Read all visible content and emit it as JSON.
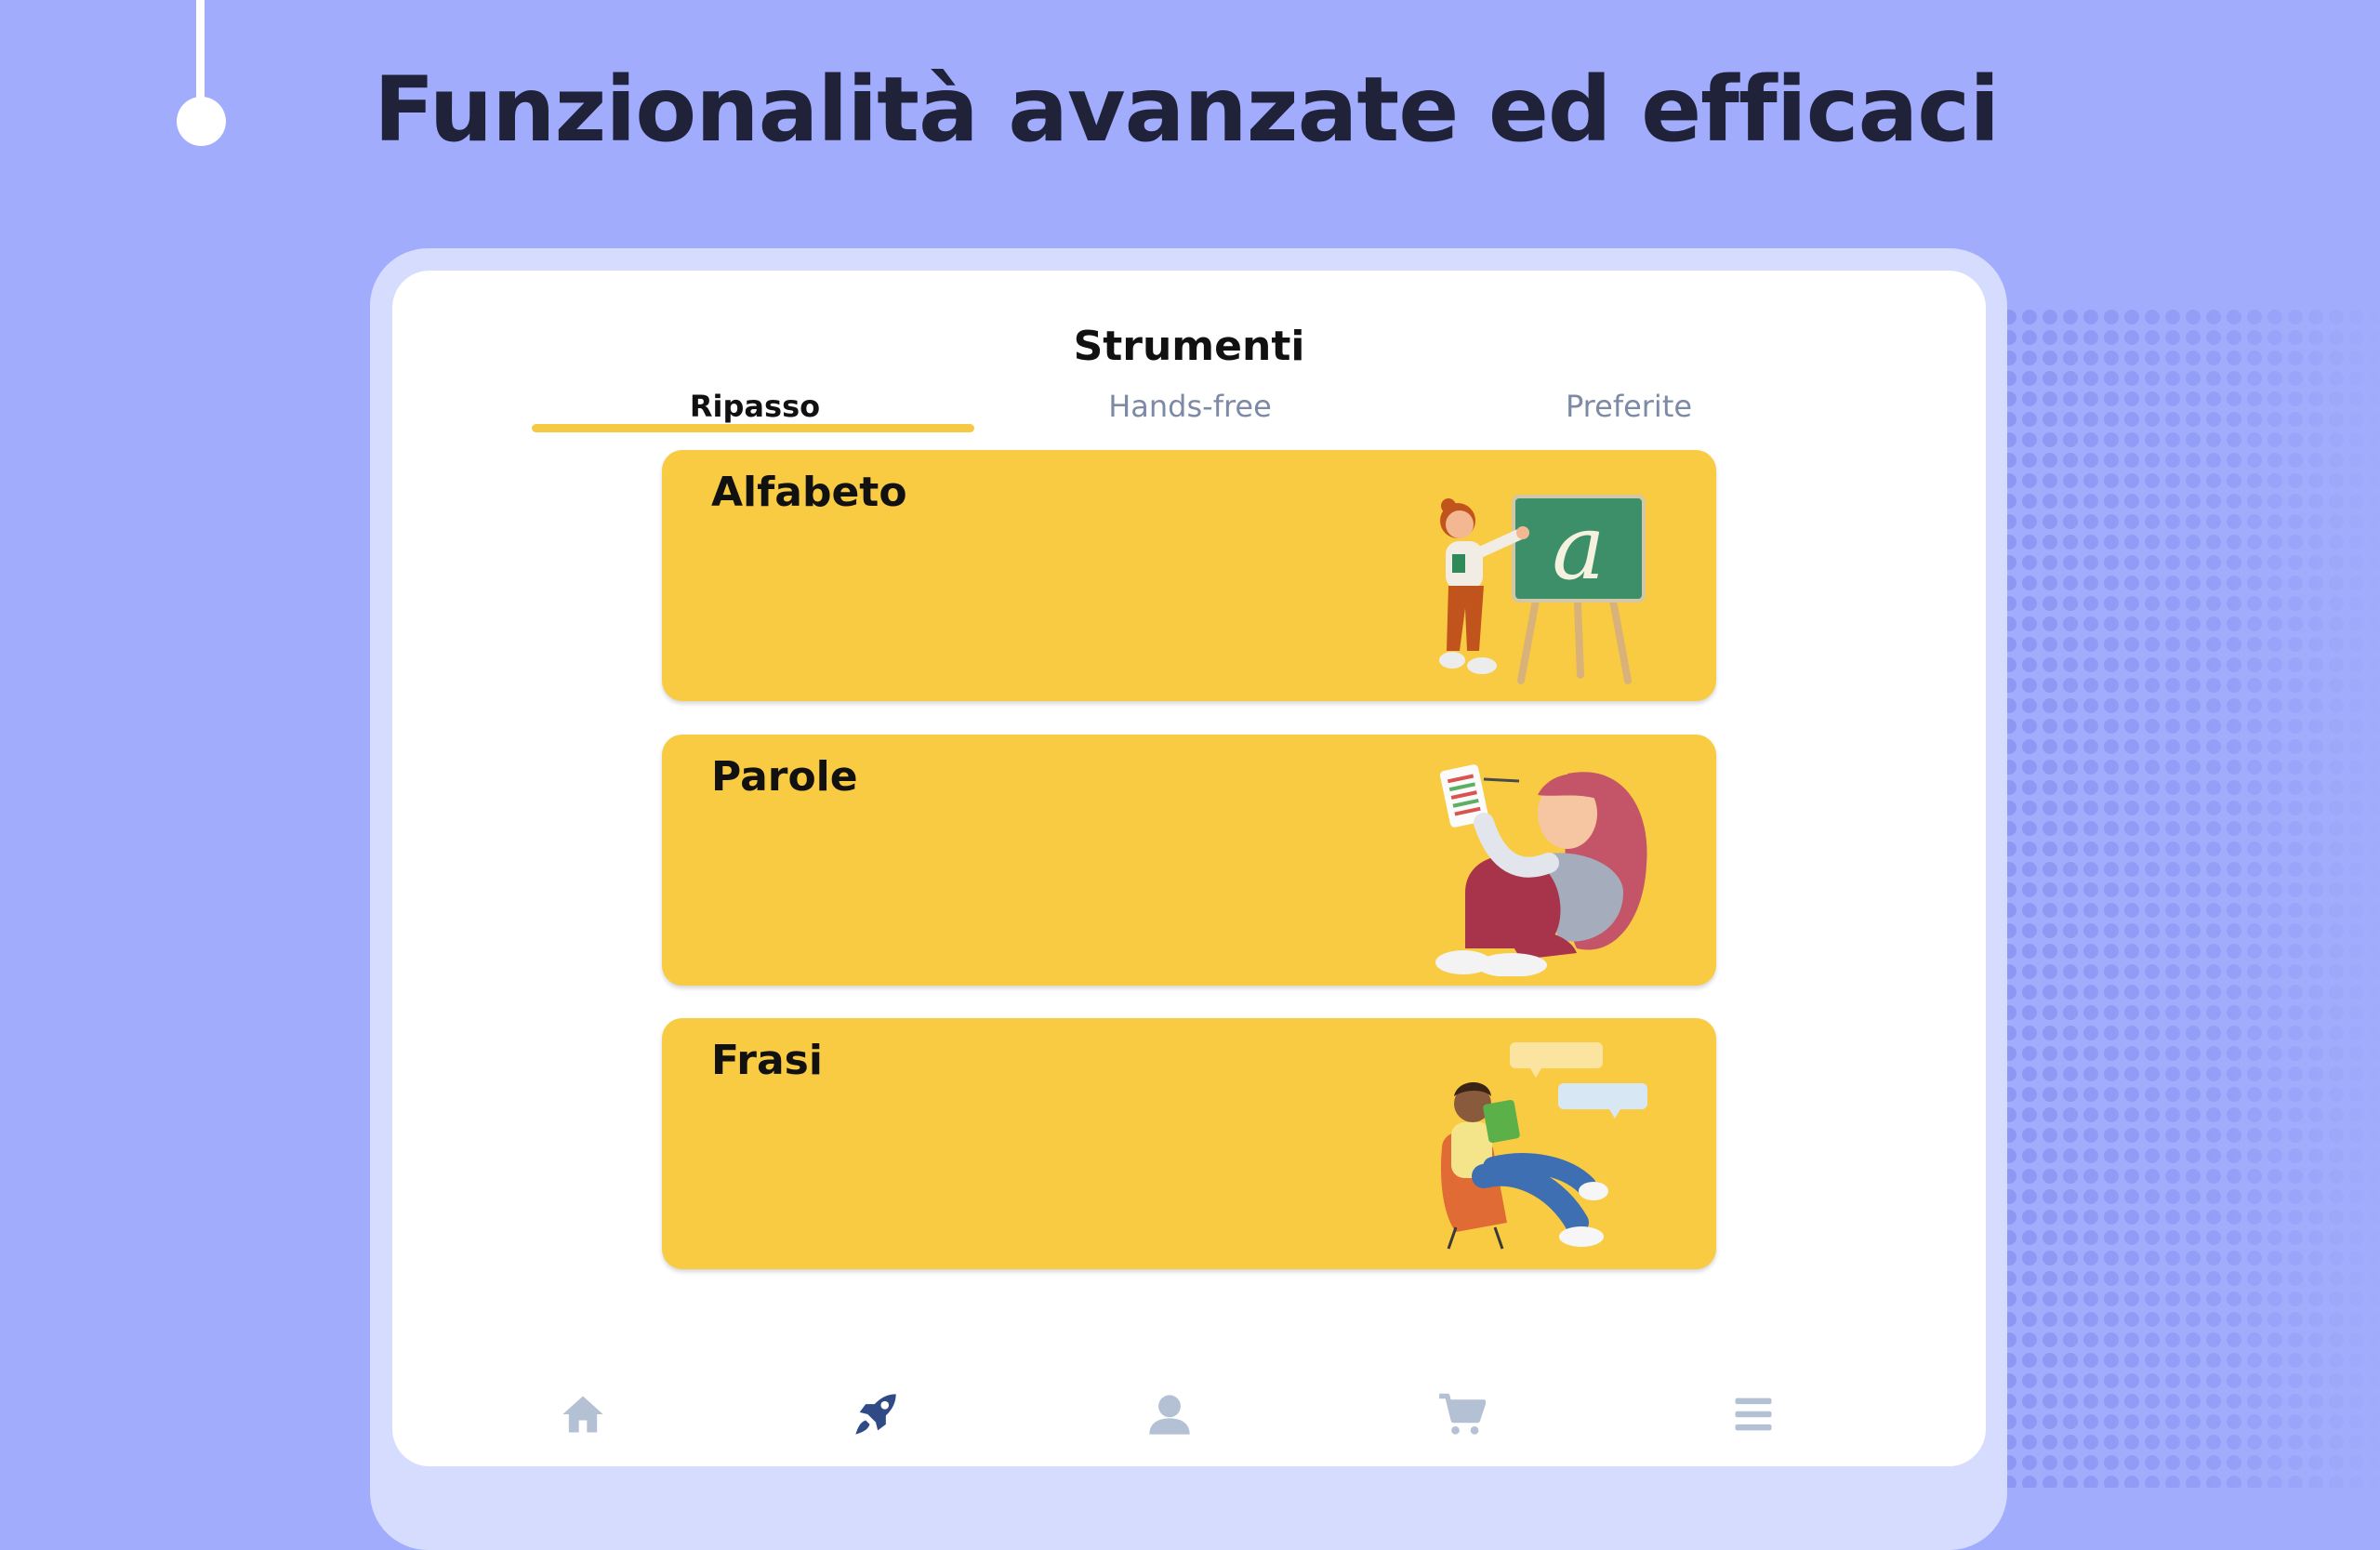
{
  "headline": "Funzionalità avanzate ed efficaci",
  "screen": {
    "title": "Strumenti",
    "tabs": [
      {
        "label": "Ripasso",
        "active": true
      },
      {
        "label": "Hands-free",
        "active": false
      },
      {
        "label": "Preferite",
        "active": false
      }
    ],
    "cards": [
      {
        "title": "Alfabeto",
        "illustration": "teacher-chalkboard-illustration"
      },
      {
        "title": "Parole",
        "illustration": "girl-writing-list-illustration"
      },
      {
        "title": "Frasi",
        "illustration": "boy-reading-chair-illustration"
      }
    ],
    "bottom_nav": [
      {
        "icon": "home-icon",
        "active": false
      },
      {
        "icon": "rocket-icon",
        "active": true
      },
      {
        "icon": "profile-icon",
        "active": false
      },
      {
        "icon": "cart-icon",
        "active": false
      },
      {
        "icon": "menu-icon",
        "active": false
      }
    ]
  },
  "colors": {
    "background": "#a1acfd",
    "card": "#f8cb43",
    "tab_underline": "#f7c843",
    "nav_active": "#2f4a85",
    "nav_inactive": "#b4c0d3"
  }
}
